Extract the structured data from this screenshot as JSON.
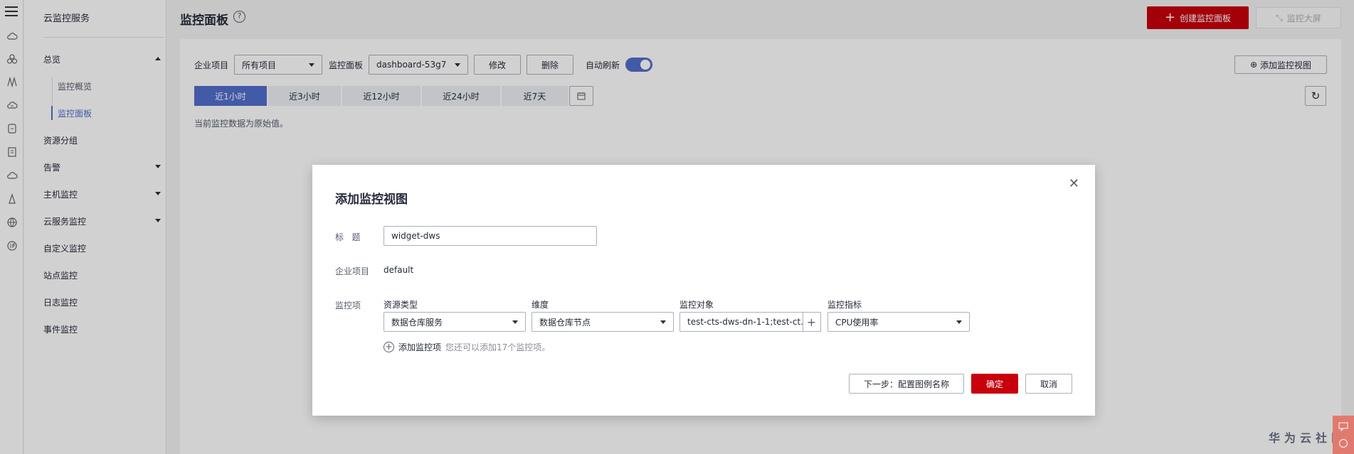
{
  "sidebar": {
    "title": "云监控服务",
    "items": [
      {
        "label": "总览",
        "arrow": "up"
      },
      {
        "label": "资源分组",
        "arrow": ""
      },
      {
        "label": "告警",
        "arrow": "down"
      },
      {
        "label": "主机监控",
        "arrow": "down"
      },
      {
        "label": "云服务监控",
        "arrow": "down"
      },
      {
        "label": "自定义监控",
        "arrow": ""
      },
      {
        "label": "站点监控",
        "arrow": ""
      },
      {
        "label": "日志监控",
        "arrow": ""
      },
      {
        "label": "事件监控",
        "arrow": ""
      }
    ],
    "sub_items": [
      {
        "label": "监控概览",
        "active": false
      },
      {
        "label": "监控面板",
        "active": true
      }
    ]
  },
  "header": {
    "title": "监控面板",
    "help_icon": "?",
    "create_button": "创建监控面板",
    "bigscreen_button": "监控大屏"
  },
  "toolbar": {
    "enterprise_label": "企业项目",
    "enterprise_value": "所有项目",
    "dashboard_label": "监控面板",
    "dashboard_value": "dashboard-53g7",
    "modify_button": "修改",
    "delete_button": "删除",
    "auto_refresh_label": "自动刷新",
    "auto_refresh_on": true,
    "add_view_button": "添加监控视图"
  },
  "time_tabs": [
    {
      "label": "近1小时",
      "active": true
    },
    {
      "label": "近3小时",
      "active": false
    },
    {
      "label": "近12小时",
      "active": false
    },
    {
      "label": "近24小时",
      "active": false
    },
    {
      "label": "近7天",
      "active": false
    }
  ],
  "note": "当前监控数据为原始值。",
  "dialog": {
    "title": "添加监控视图",
    "title_label": "标   题",
    "title_value": "widget-dws",
    "enterprise_label": "企业项目",
    "enterprise_value": "default",
    "metric_label": "监控项",
    "columns": {
      "resource_type": {
        "header": "资源类型",
        "value": "数据仓库服务"
      },
      "dimension": {
        "header": "维度",
        "value": "数据仓库节点"
      },
      "object": {
        "header": "监控对象",
        "value": "test-cts-dws-dn-1-1;test-ct..."
      },
      "indicator": {
        "header": "监控指标",
        "value": "CPU使用率"
      }
    },
    "add_item_link": "添加监控项",
    "add_item_hint": "您还可以添加17个监控项。",
    "next_button": "下一步：配置图例名称",
    "ok_button": "确定",
    "cancel_button": "取消"
  },
  "watermark": "华为云社区",
  "colors": {
    "primary_red": "#c7000b",
    "accent_blue": "#526ecc"
  }
}
